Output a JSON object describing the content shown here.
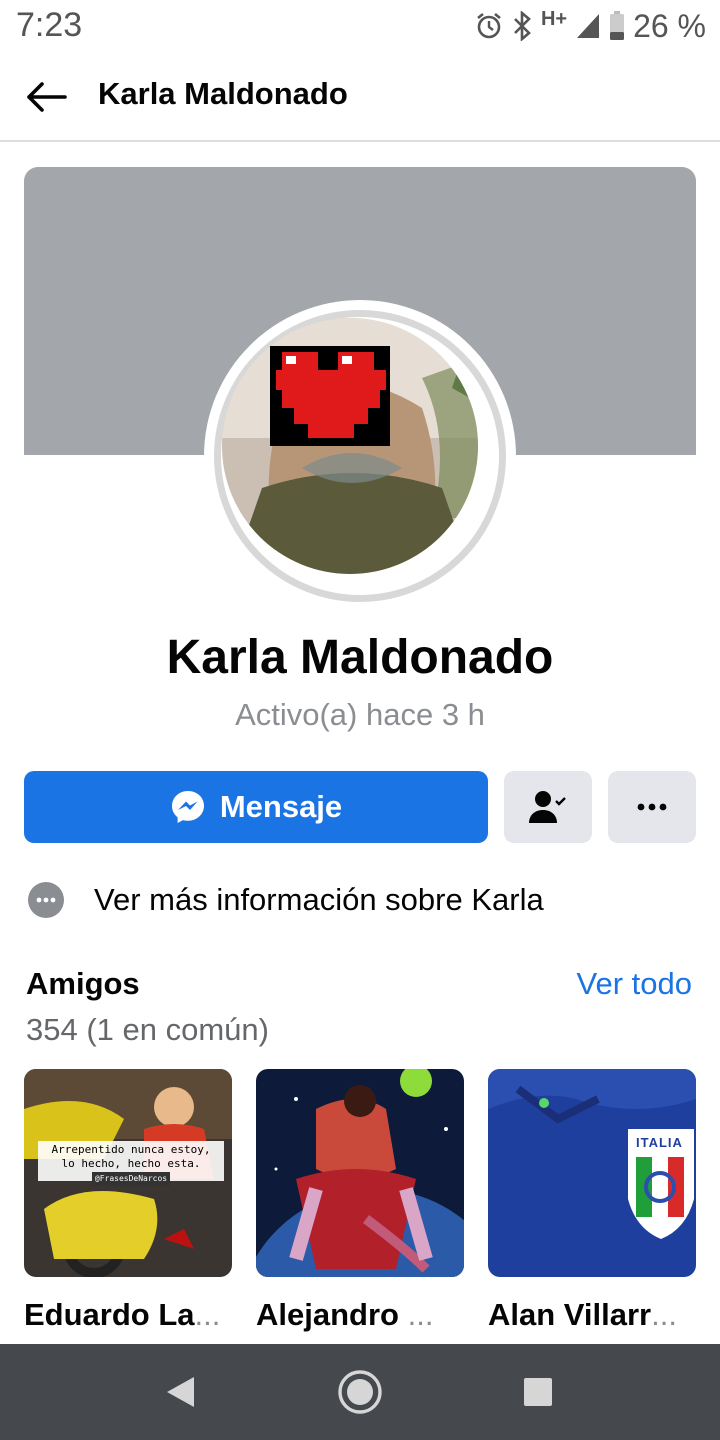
{
  "status_bar": {
    "time": "7:23",
    "network": "H+",
    "battery": "26 %",
    "icons": [
      "alarm-icon",
      "bluetooth-icon",
      "signal-icon",
      "battery-icon"
    ]
  },
  "app_bar": {
    "title": "Karla Maldonado",
    "back_icon": "arrow-left-icon"
  },
  "profile": {
    "name": "Karla Maldonado",
    "status": "Activo(a) hace 3 h",
    "cover_color": "#a3a6ab"
  },
  "actions": {
    "message_label": "Mensaje",
    "message_icon": "messenger-icon",
    "friend_icon": "friend-check-icon",
    "more_icon": "more-horizontal-icon",
    "primary_color": "#1b74e4"
  },
  "info": {
    "label": "Ver más información sobre Karla",
    "icon": "more-circle-icon"
  },
  "friends": {
    "title": "Amigos",
    "see_all": "Ver todo",
    "count": "354 (1 en común)",
    "items": [
      {
        "name": "Eduardo La",
        "meme_line1": "Arrepentido nunca estoy,",
        "meme_line2": "lo hecho, hecho esta.",
        "meme_tag": "@FrasesDeNarcos"
      },
      {
        "name": "Alejandro "
      },
      {
        "name": "Alan Villarr",
        "badge_text": "ITALIA"
      }
    ],
    "ellipsis": "..."
  },
  "nav_bar": {
    "back": "nav-back-icon",
    "home": "nav-home-icon",
    "recents": "nav-recents-icon"
  }
}
